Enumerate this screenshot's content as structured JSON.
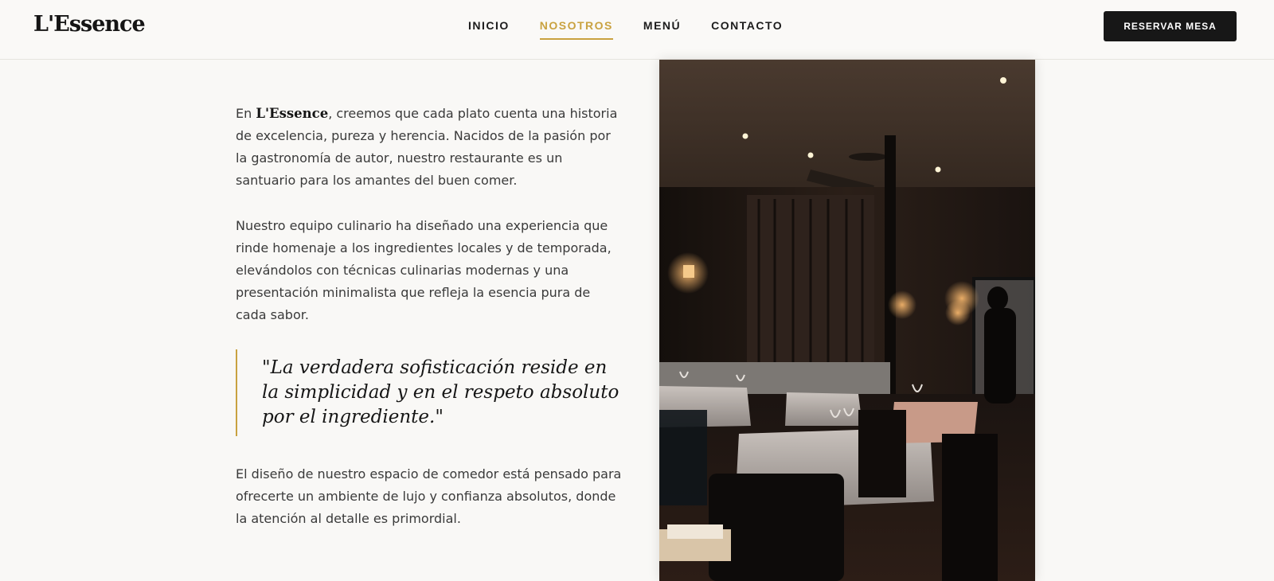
{
  "header": {
    "logo": "L'Essence",
    "nav": [
      {
        "label": "INICIO",
        "active": false
      },
      {
        "label": "NOSOTROS",
        "active": true
      },
      {
        "label": "MENÚ",
        "active": false
      },
      {
        "label": "CONTACTO",
        "active": false
      }
    ],
    "cta_label": "RESERVAR MESA"
  },
  "content": {
    "p1_before": "En ",
    "p1_brand": "L'Essence",
    "p1_after": ", creemos que cada plato cuenta una historia de excelencia, pureza y herencia. Nacidos de la pasión por la gastronomía de autor, nuestro restaurante es un santuario para los amantes del buen comer.",
    "p2": "Nuestro equipo culinario ha diseñado una experiencia que rinde homenaje a los ingredientes locales y de temporada, elevándolos con técnicas culinarias modernas y una presentación minimalista que refleja la esencia pura de cada sabor.",
    "quote": "\"La verdadera sofisticación reside en la simplicidad y en el respeto absoluto por el ingrediente.\"",
    "p3": "El diseño de nuestro espacio de comedor está pensado para ofrecerte un ambiente de lujo y confianza absolutos, donde la atención al detalle es primordial."
  },
  "colors": {
    "accent": "#c9a240",
    "background": "#f9f8f6",
    "button": "#171717"
  }
}
